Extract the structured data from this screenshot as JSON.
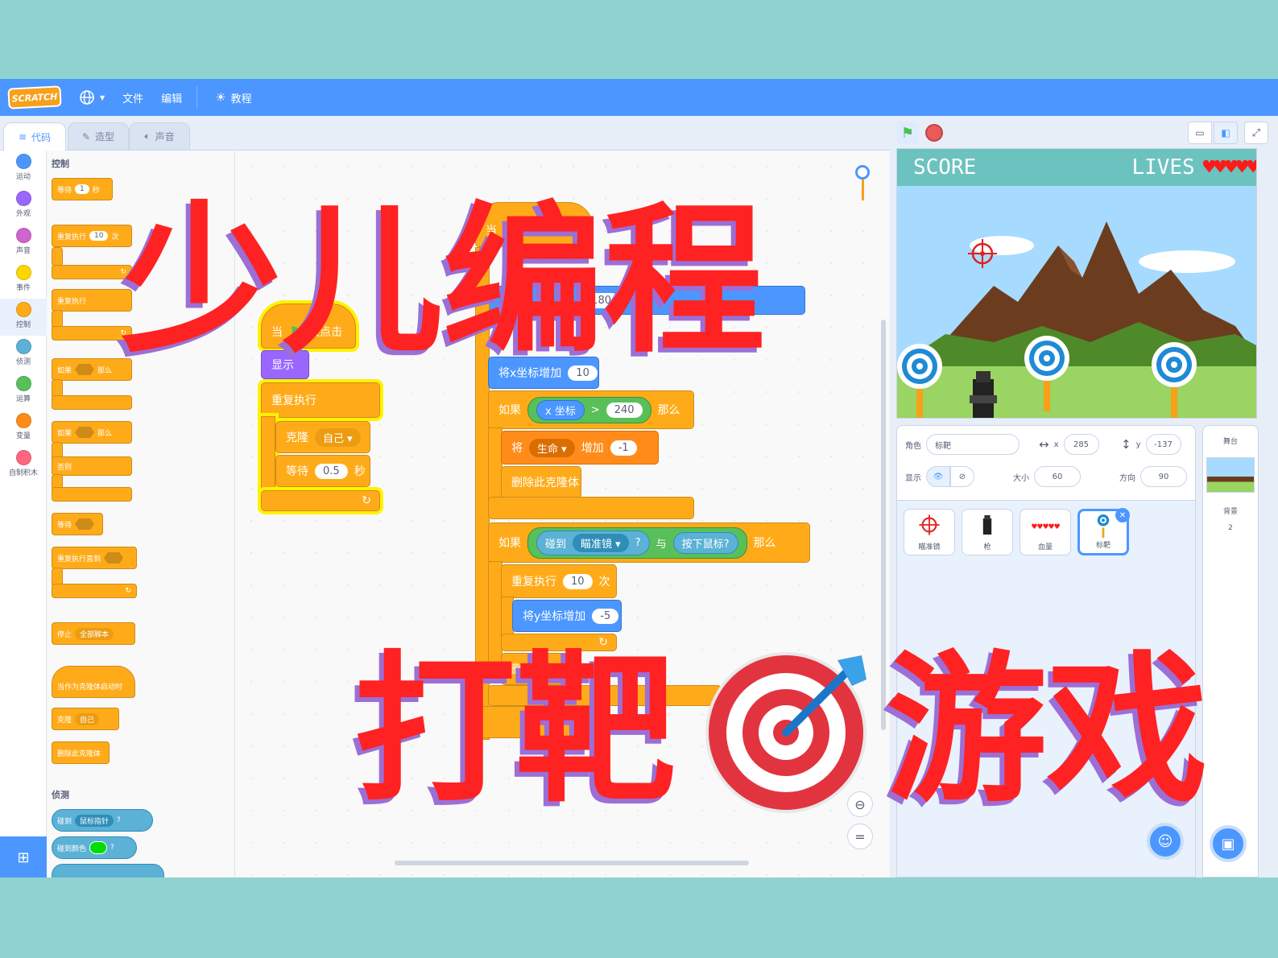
{
  "menubar": {
    "logo": "SCRATCH",
    "language_icon": "globe-icon",
    "file": "文件",
    "edit": "编辑",
    "tutorials": "教程"
  },
  "tabs": {
    "code": "代码",
    "costumes": "造型",
    "sounds": "声音"
  },
  "categories": [
    {
      "label": "运动",
      "color": "#4c97ff"
    },
    {
      "label": "外观",
      "color": "#9966ff"
    },
    {
      "label": "声音",
      "color": "#cf63cf"
    },
    {
      "label": "事件",
      "color": "#ffd500"
    },
    {
      "label": "控制",
      "color": "#ffab19"
    },
    {
      "label": "侦测",
      "color": "#5cb1d6"
    },
    {
      "label": "运算",
      "color": "#59c059"
    },
    {
      "label": "变量",
      "color": "#ff8c1a"
    },
    {
      "label": "自制积木",
      "color": "#ff6680"
    }
  ],
  "palette": {
    "control_header": "控制",
    "wait": "等待",
    "wait_val": "1",
    "sec": "秒",
    "repeat": "重复执行",
    "repeat_val": "10",
    "times": "次",
    "forever": "重复执行",
    "if": "如果",
    "then": "那么",
    "if2": "如果",
    "then2": "那么",
    "else": "否则",
    "wait_until": "等待",
    "repeat_until": "重复执行直到",
    "stop": "停止",
    "stop_val": "全部脚本",
    "clone_hat": "当作为克隆体启动时",
    "clone": "克隆",
    "clone_val": "自己",
    "delete_clone": "删除此克隆体",
    "sensing_header": "侦测",
    "touching": "碰到",
    "touching_val": "鼠标指针",
    "touching_color": "碰到颜色"
  },
  "script1": {
    "hat_when": "当",
    "hat_clicked": "被点击",
    "show": "显示",
    "forever": "重复执行",
    "clone": "克隆",
    "clone_val": "自己",
    "wait": "等待",
    "wait_val": "0.5",
    "sec": "秒"
  },
  "script2": {
    "hat": "当",
    "goto_val": "180",
    "change_x": "将x坐标增加",
    "change_x_val": "10",
    "if1": "如果",
    "xpos": "x 坐标",
    "gt": ">",
    "cmp_val": "240",
    "then1": "那么",
    "set": "将",
    "var": "生命",
    "inc": "增加",
    "inc_val": "-1",
    "delete1": "删除此克隆体",
    "if2": "如果",
    "touch": "碰到",
    "touch_val": "瞄准镜",
    "q": "?",
    "and": "与",
    "mouse": "按下鼠标?",
    "then2": "那么",
    "repeat": "重复执行",
    "repeat_val": "10",
    "times": "次",
    "change_y": "将y坐标增加",
    "change_y_val": "-5",
    "delete2": "删除此"
  },
  "overlay": {
    "title1": "少儿编程",
    "title2a": "打靶",
    "title2b": "游戏"
  },
  "stage": {
    "score": "SCORE",
    "lives": "LIVES",
    "hearts": "♥♥♥♥♥"
  },
  "sprite_info": {
    "sprite_label": "角色",
    "sprite_name": "标靶",
    "x_label": "x",
    "x": "285",
    "y_label": "y",
    "y": "-137",
    "show_label": "显示",
    "size_label": "大小",
    "size": "60",
    "direction_label": "方向",
    "direction": "90"
  },
  "sprites": [
    {
      "name": "瞄准镜"
    },
    {
      "name": "枪"
    },
    {
      "name": "血量"
    },
    {
      "name": "标靶"
    }
  ],
  "stage_panel": {
    "title": "舞台",
    "backdrops_label": "背景",
    "backdrops_count": "2"
  }
}
